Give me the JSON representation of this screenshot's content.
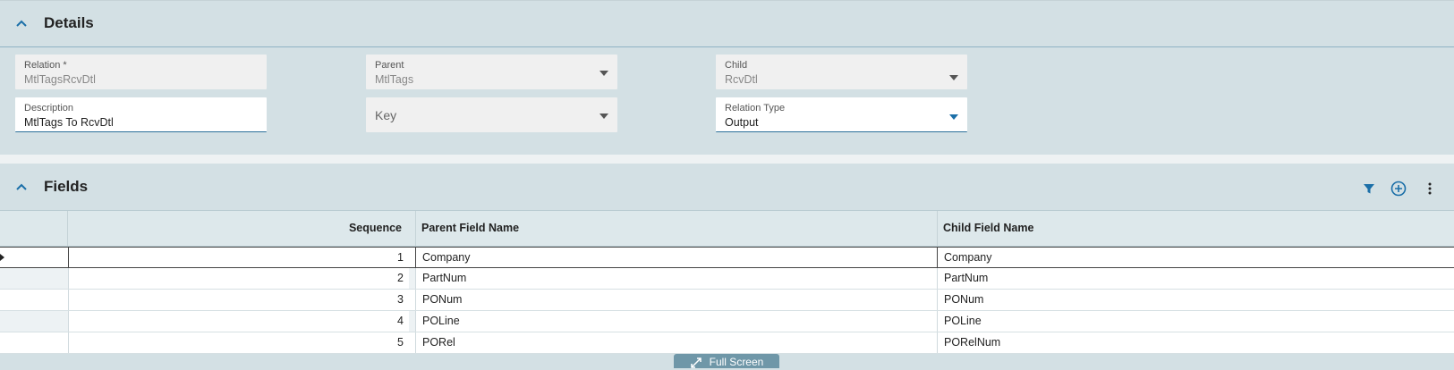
{
  "details": {
    "title": "Details",
    "relation": {
      "label": "Relation *",
      "value": "MtlTagsRcvDtl"
    },
    "parent": {
      "label": "Parent",
      "value": "MtlTags"
    },
    "child": {
      "label": "Child",
      "value": "RcvDtl"
    },
    "description": {
      "label": "Description",
      "value": "MtlTags To RcvDtl"
    },
    "key": {
      "placeholder": "Key"
    },
    "relation_type": {
      "label": "Relation Type",
      "value": "Output"
    }
  },
  "fields": {
    "title": "Fields",
    "columns": [
      "Sequence",
      "Parent Field Name",
      "Child Field Name"
    ],
    "rows": [
      {
        "sequence": "1",
        "parent": "Company",
        "child": "Company"
      },
      {
        "sequence": "2",
        "parent": "PartNum",
        "child": "PartNum"
      },
      {
        "sequence": "3",
        "parent": "PONum",
        "child": "PONum"
      },
      {
        "sequence": "4",
        "parent": "POLine",
        "child": "POLine"
      },
      {
        "sequence": "5",
        "parent": "PORel",
        "child": "PORelNum"
      }
    ],
    "selected_row": 0
  },
  "toolbar": {
    "icons": [
      "filter-icon",
      "add-circle-icon",
      "more-vertical-icon"
    ]
  },
  "fullscreen": {
    "label": "Full Screen"
  },
  "colors": {
    "accent": "#1b6fa8",
    "panel": "#d3e0e4",
    "fullscreen_button": "#6f97a8"
  }
}
